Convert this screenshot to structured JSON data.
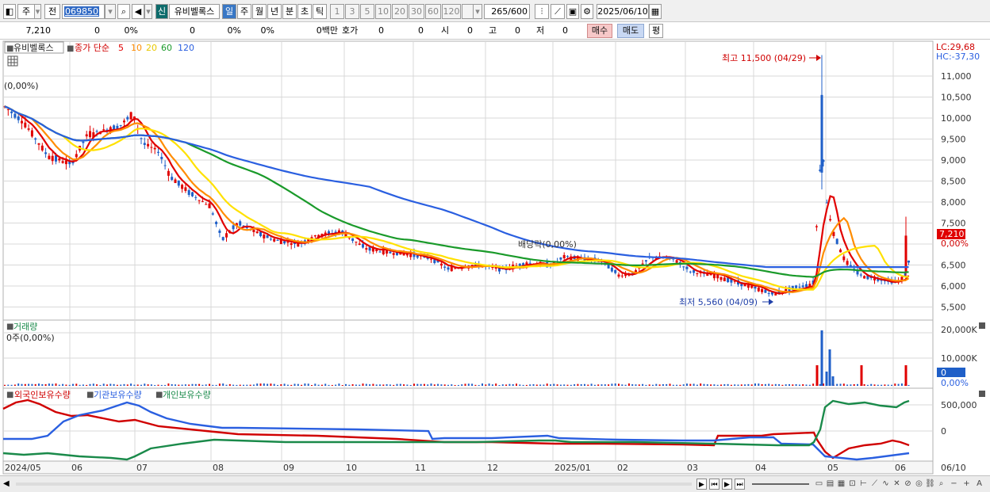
{
  "toolbar": {
    "period": "주",
    "prev": "전",
    "code": "069850",
    "new_badge": "신",
    "stock_name": "유비벨록스",
    "timeframes": [
      "일",
      "주",
      "월",
      "년",
      "분",
      "초",
      "틱"
    ],
    "active_timeframe": "일",
    "intervals": [
      "1",
      "3",
      "5",
      "10",
      "20",
      "30",
      "60",
      "120"
    ],
    "count": "265",
    "count_total": "/600",
    "date": "2025/06/10"
  },
  "infobar": {
    "price": "7,210",
    "change": "0",
    "change_pct": "0%",
    "volume": "0",
    "volume_pct": "0%",
    "turnover_pct": "0%",
    "amount": "0백만",
    "quote_label": "호가",
    "quote1": "0",
    "quote2": "0",
    "open_label": "시",
    "open": "0",
    "high_label": "고",
    "high": "0",
    "low_label": "저",
    "low": "0",
    "buy": "매수",
    "sell": "매도",
    "avg": "평"
  },
  "price_panel": {
    "name": "유비벨록스",
    "ma_label": "종가 단순",
    "ma_periods": [
      "5",
      "10",
      "20",
      "60",
      "120"
    ],
    "ma_colors": [
      "#e10000",
      "#ff8c00",
      "#ffe100",
      "#1a9a2a",
      "#2a5fe0"
    ],
    "pct_note": "(0,00%)",
    "lc": "LC:29,68",
    "hc": "HC:-37,30",
    "current_price": "7,210",
    "current_pct": "0,00%",
    "high_annotation": "최고 11,500 (04/29)",
    "low_annotation": "최저 5,560 (04/09)",
    "dividend_annotation": "배당락(0,00%)",
    "y_ticks": [
      "11,000",
      "10,500",
      "10,000",
      "9,500",
      "9,000",
      "8,500",
      "8,000",
      "7,500",
      "6,500",
      "6,000",
      "5,500"
    ]
  },
  "volume_panel": {
    "title": "거래량",
    "note": "0주(0,00%)",
    "y_ticks": [
      "20,000K",
      "10,000K"
    ],
    "current": "0",
    "current_pct": "0,00%"
  },
  "holdings_panel": {
    "series": [
      "외국인보유수량",
      "기관보유수량",
      "개인보유수량"
    ],
    "colors": [
      "#d00000",
      "#2a5fe0",
      "#1a8a4a"
    ],
    "y_ticks": [
      "500,000",
      "0"
    ]
  },
  "x_axis": [
    "2024/05",
    "06",
    "07",
    "08",
    "09",
    "10",
    "11",
    "12",
    "2025/01",
    "02",
    "03",
    "04",
    "05",
    "06"
  ],
  "x_axis_right": "06/10",
  "colors": {
    "up": "#e00000",
    "down": "#1f5fc8",
    "grid": "#d8d8d8"
  }
}
